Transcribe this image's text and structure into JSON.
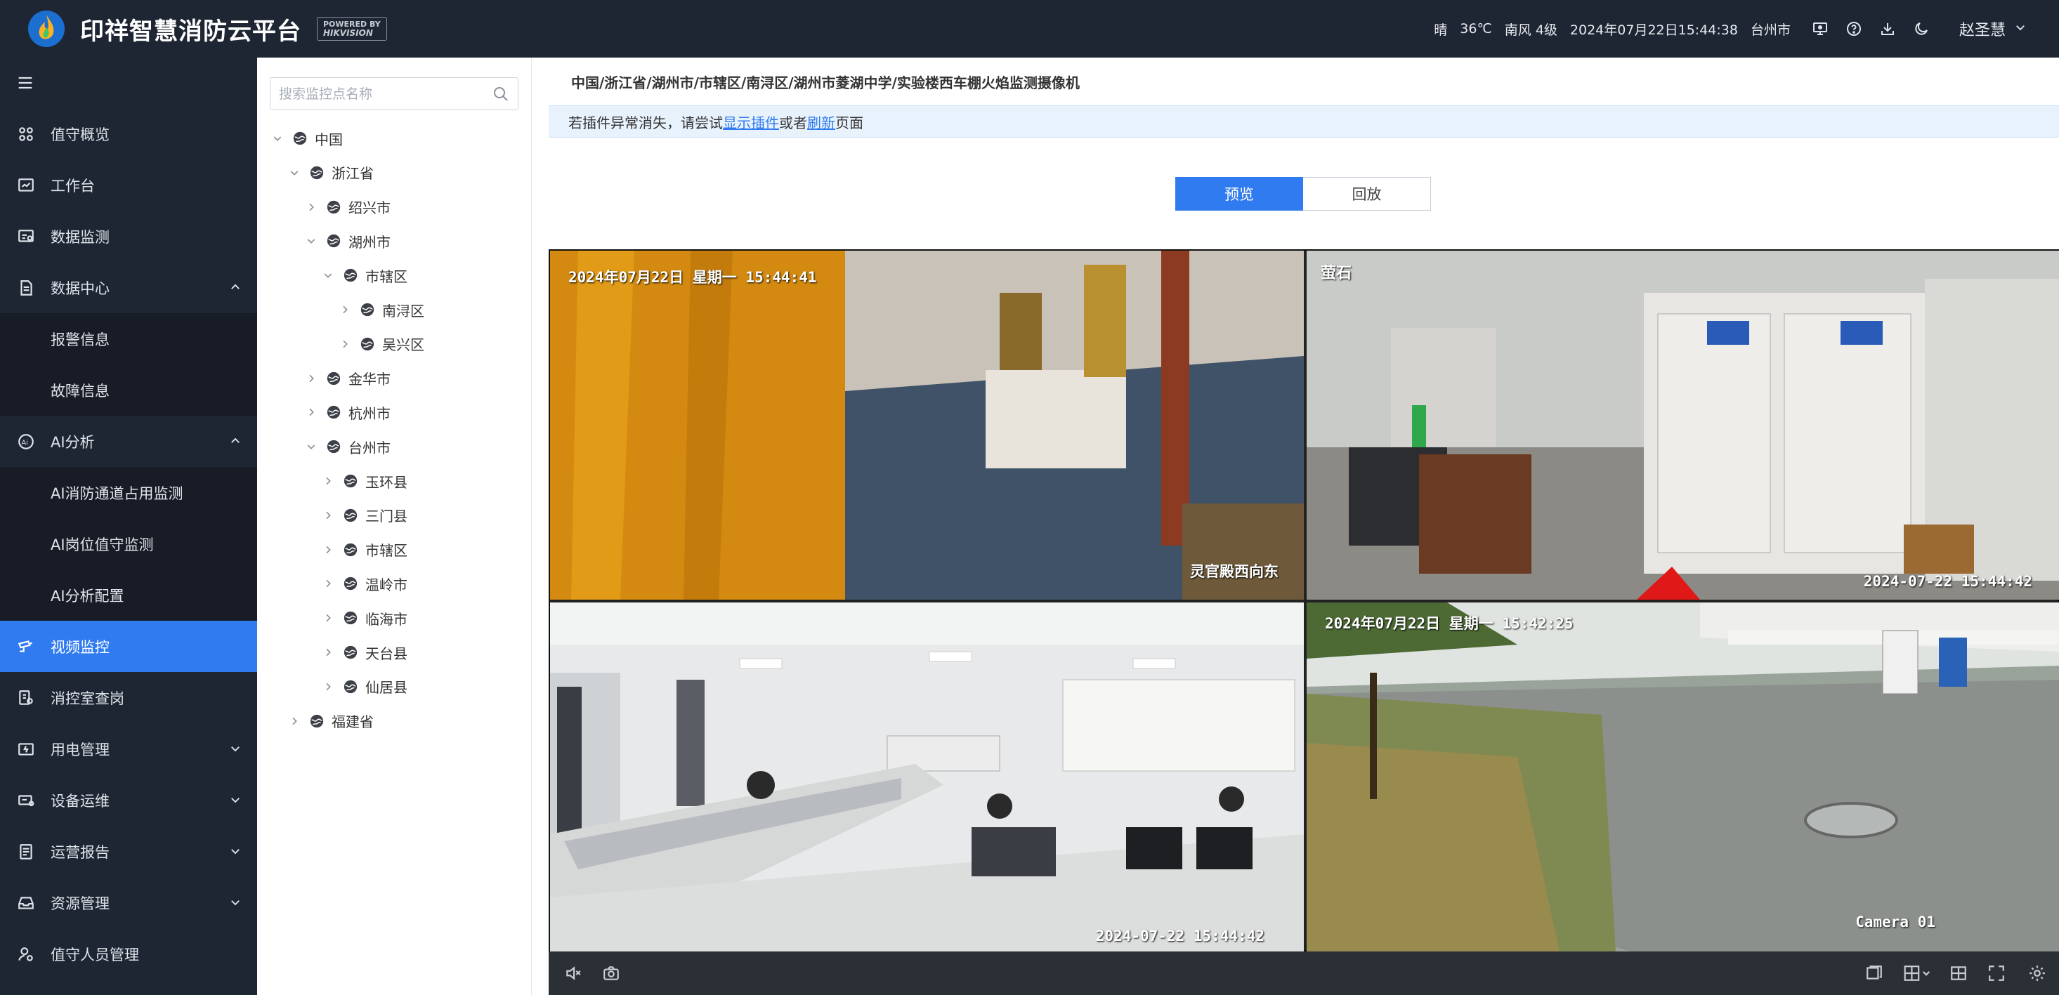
{
  "app": {
    "title": "印祥智慧消防云平台",
    "powered_by": "POWERED BY",
    "powered_brand": "HIKVISION"
  },
  "topbar": {
    "weather": "晴",
    "temperature": "36℃",
    "wind": "南风 4级",
    "datetime": "2024年07月22日15:44:38",
    "city": "台州市",
    "user": "赵圣慧",
    "icons": [
      "monitor-icon",
      "help-icon",
      "download-icon",
      "moon-icon"
    ]
  },
  "sidebar": {
    "items": [
      {
        "label": "值守概览",
        "icon": "overview-icon"
      },
      {
        "label": "工作台",
        "icon": "workbench-icon"
      },
      {
        "label": "数据监测",
        "icon": "data-monitor-icon"
      },
      {
        "label": "数据中心",
        "icon": "document-icon",
        "expanded": true
      },
      {
        "label": "报警信息"
      },
      {
        "label": "故障信息"
      },
      {
        "label": "AI分析",
        "icon": "ai-icon",
        "expanded": true
      },
      {
        "label": "AI消防通道占用监测"
      },
      {
        "label": "AI岗位值守监测"
      },
      {
        "label": "AI分析配置"
      },
      {
        "label": "视频监控",
        "icon": "camera-icon",
        "active": true
      },
      {
        "label": "消控室查岗",
        "icon": "check-icon"
      },
      {
        "label": "用电管理",
        "icon": "power-icon"
      },
      {
        "label": "设备运维",
        "icon": "device-icon"
      },
      {
        "label": "运营报告",
        "icon": "report-icon"
      },
      {
        "label": "资源管理",
        "icon": "resource-icon"
      },
      {
        "label": "值守人员管理",
        "icon": "user-manage-icon"
      }
    ]
  },
  "tree": {
    "search_placeholder": "搜索监控点名称",
    "nodes": [
      {
        "label": "中国",
        "arrow": "down"
      },
      {
        "label": "浙江省",
        "arrow": "down"
      },
      {
        "label": "绍兴市",
        "arrow": "right"
      },
      {
        "label": "湖州市",
        "arrow": "down"
      },
      {
        "label": "市辖区",
        "arrow": "down"
      },
      {
        "label": "南浔区",
        "arrow": "right"
      },
      {
        "label": "吴兴区",
        "arrow": "right"
      },
      {
        "label": "金华市",
        "arrow": "right"
      },
      {
        "label": "杭州市",
        "arrow": "right"
      },
      {
        "label": "台州市",
        "arrow": "down"
      },
      {
        "label": "玉环县",
        "arrow": "right"
      },
      {
        "label": "三门县",
        "arrow": "right"
      },
      {
        "label": "市辖区",
        "arrow": "right"
      },
      {
        "label": "温岭市",
        "arrow": "right"
      },
      {
        "label": "临海市",
        "arrow": "right"
      },
      {
        "label": "天台县",
        "arrow": "right"
      },
      {
        "label": "仙居县",
        "arrow": "right"
      },
      {
        "label": "福建省",
        "arrow": "right"
      }
    ]
  },
  "main": {
    "breadcrumb": "中国/浙江省/湖州市/市辖区/南浔区/湖州市菱湖中学/实验楼西车棚火焰监测摄像机",
    "notice_prefix": "若插件异常消失，请尝试",
    "notice_link1": "显示插件",
    "notice_middle": "或者",
    "notice_link2": "刷新",
    "notice_suffix": "页面",
    "tabs": {
      "preview": "预览",
      "playback": "回放"
    }
  },
  "videos": [
    {
      "osd_top": "2024年07月22日 星期一 15:44:41",
      "osd_bottom": "灵官殿西向东"
    },
    {
      "osd_top": "萤石",
      "osd_bottom": "2024-07-22 15:44:42"
    },
    {
      "osd_top": "",
      "osd_bottom": "2024-07-22 15:44:42"
    },
    {
      "osd_top": "2024年07月22日 星期一 15:42:25",
      "osd_bottom": "Camera 01"
    }
  ],
  "video_toolbar": {
    "left_icons": [
      "mute-icon",
      "snapshot-icon"
    ],
    "right_icons": [
      "window-icon",
      "layout-icon",
      "split-icon",
      "fullscreen-icon",
      "settings-icon"
    ]
  },
  "colors": {
    "topbar_bg": "#1f2633",
    "accent": "#2f7bef",
    "sidebar_sub_bg": "#171c26"
  }
}
